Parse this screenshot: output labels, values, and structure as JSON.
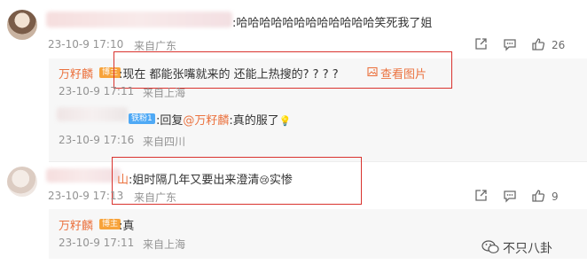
{
  "comment1": {
    "text": ":哈哈哈哈哈哈哈哈哈哈哈哈笑死我了姐",
    "time": "23-10-9 17:10",
    "location": "来自广东",
    "like_count": "26"
  },
  "reply1": {
    "name": "万籽麟",
    "badge": "博主",
    "text": ":现在 都能张嘴就来的 还能上热搜的? ? ? ?",
    "view_image": "查看图片",
    "time": "23-10-9 17:11",
    "location": "来自上海"
  },
  "reply2": {
    "badge": "铁粉1",
    "reply_prefix": ":回复",
    "mention": "@万籽麟",
    "text": ":真的服了",
    "emoji": "💡",
    "time": "23-10-9 17:16",
    "location": "来自四川"
  },
  "comment2": {
    "name_tail": "山",
    "text": ":姐时隔几年又要出来澄清",
    "emoji": "😢",
    "text_tail": "实惨",
    "time": "23-10-9 17:13",
    "location": "来自广东",
    "like_count": "9"
  },
  "reply3": {
    "name": "万籽麟",
    "badge": "博主",
    "text": ":真",
    "time": "23-10-9 17:11",
    "location": "来自上海"
  },
  "watermark": {
    "text": "不只八卦"
  },
  "colors": {
    "accent": "#eb7340",
    "highlight_box": "#d9332e"
  }
}
